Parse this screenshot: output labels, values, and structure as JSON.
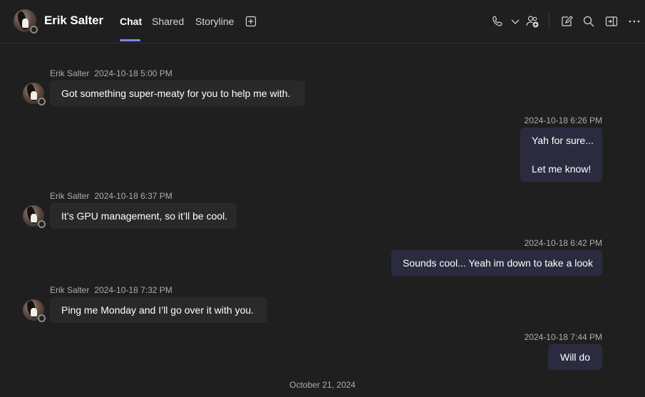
{
  "header": {
    "name": "Erik Salter",
    "tabs": [
      {
        "label": "Chat",
        "active": true
      },
      {
        "label": "Shared",
        "active": false
      },
      {
        "label": "Storyline",
        "active": false
      }
    ],
    "icons": [
      "add-tab-icon",
      "phone-icon",
      "chevron-down-icon",
      "add-people-icon",
      "new-chat-icon",
      "search-icon",
      "popout-icon",
      "more-options-icon"
    ]
  },
  "messages": [
    {
      "direction": "incoming",
      "sender": "Erik Salter",
      "time": "2024-10-18 5:00 PM",
      "lines": [
        "Got something super-meaty for you to help me with."
      ]
    },
    {
      "direction": "outgoing",
      "time": "2024-10-18 6:26 PM",
      "lines": [
        "Yah for sure...",
        "Let me know!"
      ]
    },
    {
      "direction": "incoming",
      "sender": "Erik Salter",
      "time": "2024-10-18 6:37 PM",
      "lines": [
        "It’s GPU management, so it’ll be cool."
      ]
    },
    {
      "direction": "outgoing",
      "time": "2024-10-18 6:42 PM",
      "lines": [
        "Sounds cool... Yeah im down to take a look"
      ]
    },
    {
      "direction": "incoming",
      "sender": "Erik Salter",
      "time": "2024-10-18 7:32 PM",
      "lines": [
        "Ping me Monday and I’ll go over it with you."
      ]
    },
    {
      "direction": "outgoing",
      "time": "2024-10-18 7:44 PM",
      "lines": [
        "Will do"
      ]
    }
  ],
  "date_separator": "October 21, 2024",
  "colors": {
    "background": "#1f1f1f",
    "incoming_bubble": "#292929",
    "outgoing_bubble": "#2b2b40",
    "accent": "#7f85f5"
  }
}
